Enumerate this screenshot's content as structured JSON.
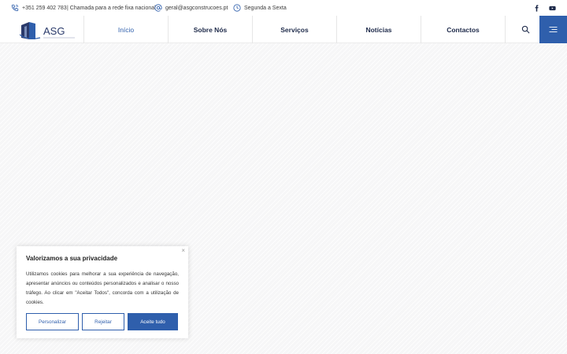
{
  "topbar": {
    "phone": "+351 259 402 783",
    "phone_note": "| Chamada para a rede fixa nacional",
    "email": "geral@asgconstrucoes.pt",
    "hours": "Segunda a Sexta"
  },
  "social": {
    "facebook_icon": "facebook-icon",
    "youtube_icon": "youtube-icon"
  },
  "logo": {
    "text": "ASG"
  },
  "nav": {
    "items": [
      "Início",
      "Sobre Nós",
      "Serviços",
      "Notícias",
      "Contactos"
    ]
  },
  "colors": {
    "accent": "#2f5fac",
    "nav_text": "#1e2a4a"
  },
  "cookie": {
    "close": "×",
    "title": "Valorizamos a sua privacidade",
    "text": "Utilizamos cookies para melhorar a sua experiência de navegação, apresentar anúncios ou conteúdos personalizados e analisar o nosso tráfego. Ao clicar em \"Aceitar Todos\", concorda com a utilização de cookies.",
    "customize": "Personalizar",
    "reject": "Rejeitar",
    "accept": "Aceite tudo"
  }
}
